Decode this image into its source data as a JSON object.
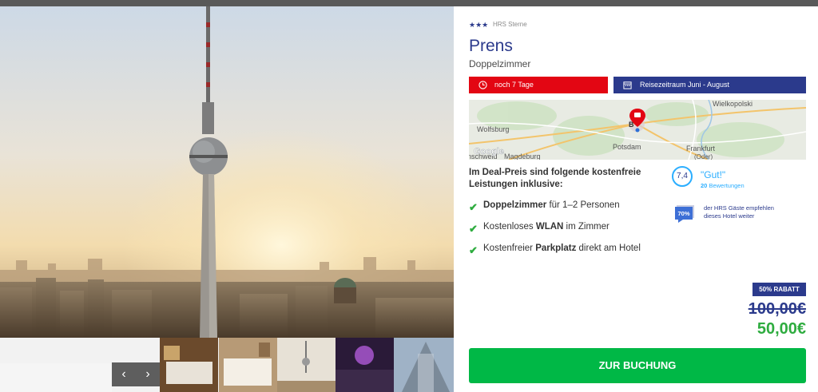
{
  "gallery": {
    "prev_label": "‹",
    "next_label": "›"
  },
  "hotel": {
    "stars_icon": "★★★",
    "stars_label": "HRS Sterne",
    "name": "Prens",
    "room_type": "Doppelzimmer"
  },
  "badges": {
    "countdown": "noch 7 Tage",
    "travel_period": "Reisezeitraum Juni - August"
  },
  "map": {
    "labels": [
      "Wielkopolski",
      "Wolfsburg",
      "Potsdam",
      "Frankfurt",
      "(Oder)",
      "Magdeburg",
      "nschweid",
      "Google",
      "B"
    ]
  },
  "inclusions": {
    "title": "Im Deal-Preis sind folgende kostenfreie Leistungen inklusive:",
    "items": [
      {
        "bold": "Doppelzimmer",
        "pre": "",
        "post": " für 1–2 Personen"
      },
      {
        "pre": "Kostenloses ",
        "bold": "WLAN",
        "post": " im Zimmer"
      },
      {
        "pre": "Kostenfreier ",
        "bold": "Parkplatz",
        "post": " direkt am Hotel"
      }
    ]
  },
  "rating": {
    "score": "7,4",
    "word": "\"Gut!\"",
    "count": "20",
    "count_label": "Bewertungen",
    "recommend_percent": "70%",
    "recommend_text": "der HRS Gäste empfehlen dieses Hotel weiter"
  },
  "pricing": {
    "discount": "50% RABATT",
    "old_price": "100,00€",
    "new_price": "50,00€"
  },
  "cta": {
    "book_label": "ZUR BUCHUNG"
  },
  "colors": {
    "brand_blue": "#2b3a8c",
    "accent_red": "#e30613",
    "success_green": "#00b846",
    "rating_cyan": "#2baeff"
  }
}
